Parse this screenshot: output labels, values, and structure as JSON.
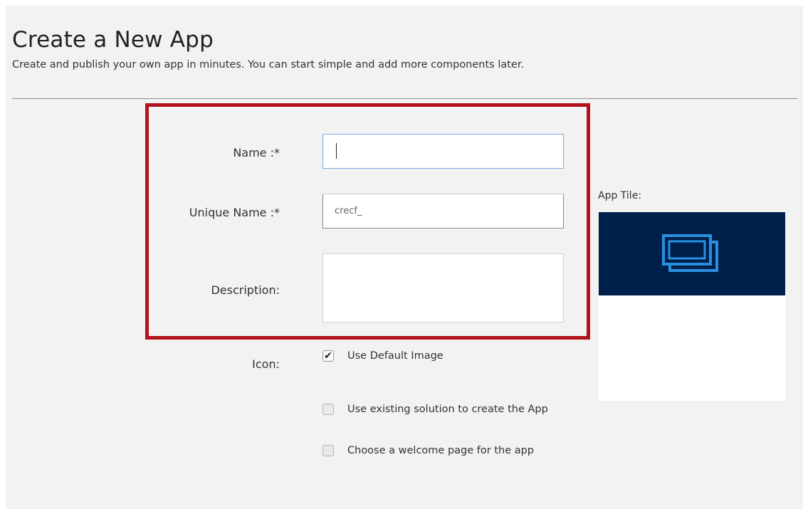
{
  "header": {
    "title": "Create a New App",
    "subtitle": "Create and publish your own app in minutes. You can start simple and add more components later."
  },
  "form": {
    "name_label": "Name :*",
    "name_value": "",
    "unique_name_label": "Unique Name :*",
    "unique_name_value": "crecf_",
    "description_label": "Description:",
    "description_value": "",
    "icon_label": "Icon:",
    "use_default_image": {
      "label": "Use Default Image",
      "checked": true
    },
    "use_existing_solution": {
      "label": "Use existing solution to create the App",
      "checked": false
    },
    "choose_welcome_page": {
      "label": "Choose a welcome page for the app",
      "checked": false
    }
  },
  "app_tile": {
    "label": "App Tile:",
    "icon": "app-windows-icon",
    "banner_color": "#00204c",
    "icon_color": "#2a8fe0"
  },
  "colors": {
    "highlight": "#b3121a",
    "focus_border": "#79a7e8"
  }
}
